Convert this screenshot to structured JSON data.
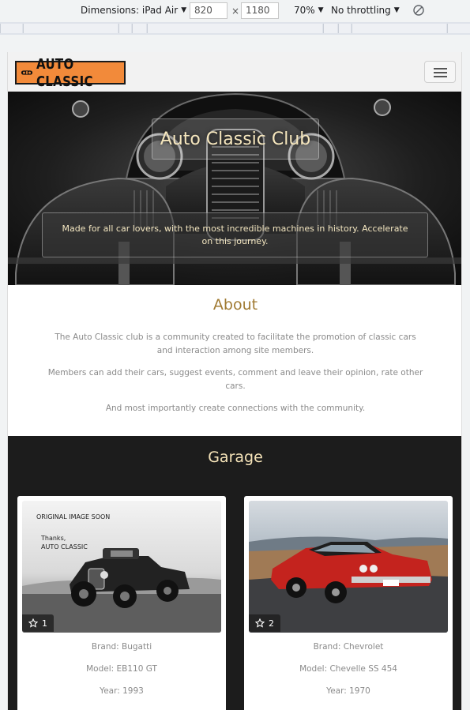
{
  "devtools": {
    "dimensions_label": "Dimensions: iPad Air",
    "width": "820",
    "height": "1180",
    "times": "×",
    "zoom": "70%",
    "throttling": "No throttling"
  },
  "navbar": {
    "logo_text": "AUTO CLASSIC"
  },
  "hero": {
    "title": "Auto Classic Club",
    "description": "Made for all car lovers, with the most incredible machines in history. Accelerate on this journey."
  },
  "about": {
    "title": "About",
    "paragraphs": [
      "The Auto Classic club is a community created to facilitate the promotion of classic cars and interaction among site members.",
      "Members can add their cars, suggest events, comment and leave their opinion, rate other cars.",
      "And most importantly create connections with the community."
    ]
  },
  "garage": {
    "title": "Garage",
    "cards": [
      {
        "overlay_line1": "ORIGINAL IMAGE SOON",
        "overlay_line2": "Thanks,",
        "overlay_line3": "AUTO CLASSIC",
        "rating": "1",
        "brand": "Brand: Bugatti",
        "model": "Model: EB110 GT",
        "year": "Year: 1993"
      },
      {
        "rating": "2",
        "brand": "Brand: Chevrolet",
        "model": "Model: Chevelle SS 454",
        "year": "Year: 1970"
      }
    ]
  },
  "colors": {
    "accent_gold": "#a07a32",
    "hero_text": "#f5e6bd",
    "logo_orange": "#f28a3a",
    "garage_bg": "#1c1c1c"
  },
  "icons": [
    "dropdown-caret-icon",
    "rotate-icon",
    "hamburger-menu-icon",
    "star-icon",
    "car-logo-icon"
  ]
}
